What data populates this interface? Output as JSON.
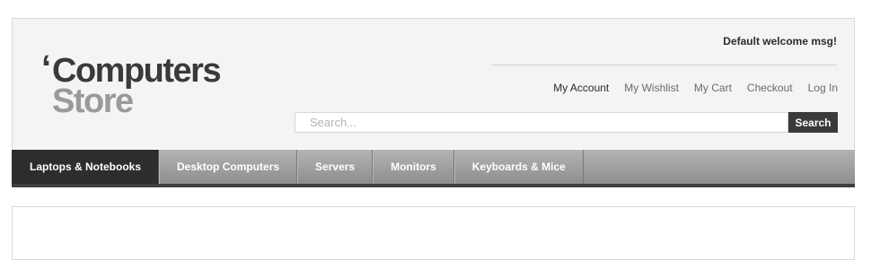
{
  "logo": {
    "quote": "‘",
    "line1": "Computers",
    "line2": "Store"
  },
  "header": {
    "welcome": "Default welcome msg!",
    "links": [
      "My Account",
      "My Wishlist",
      "My Cart",
      "Checkout",
      "Log In"
    ]
  },
  "search": {
    "placeholder": "Search...",
    "value": "",
    "button_label": "Search"
  },
  "nav": {
    "items": [
      "Laptops & Notebooks",
      "Desktop Computers",
      "Servers",
      "Monitors",
      "Keyboards & Mice"
    ],
    "active_index": 0
  },
  "colors": {
    "nav_active": "#2d2d2d",
    "search_button": "#3a3a3a",
    "logo_primary": "#3a3a3a",
    "logo_secondary": "#9a9a9a"
  }
}
